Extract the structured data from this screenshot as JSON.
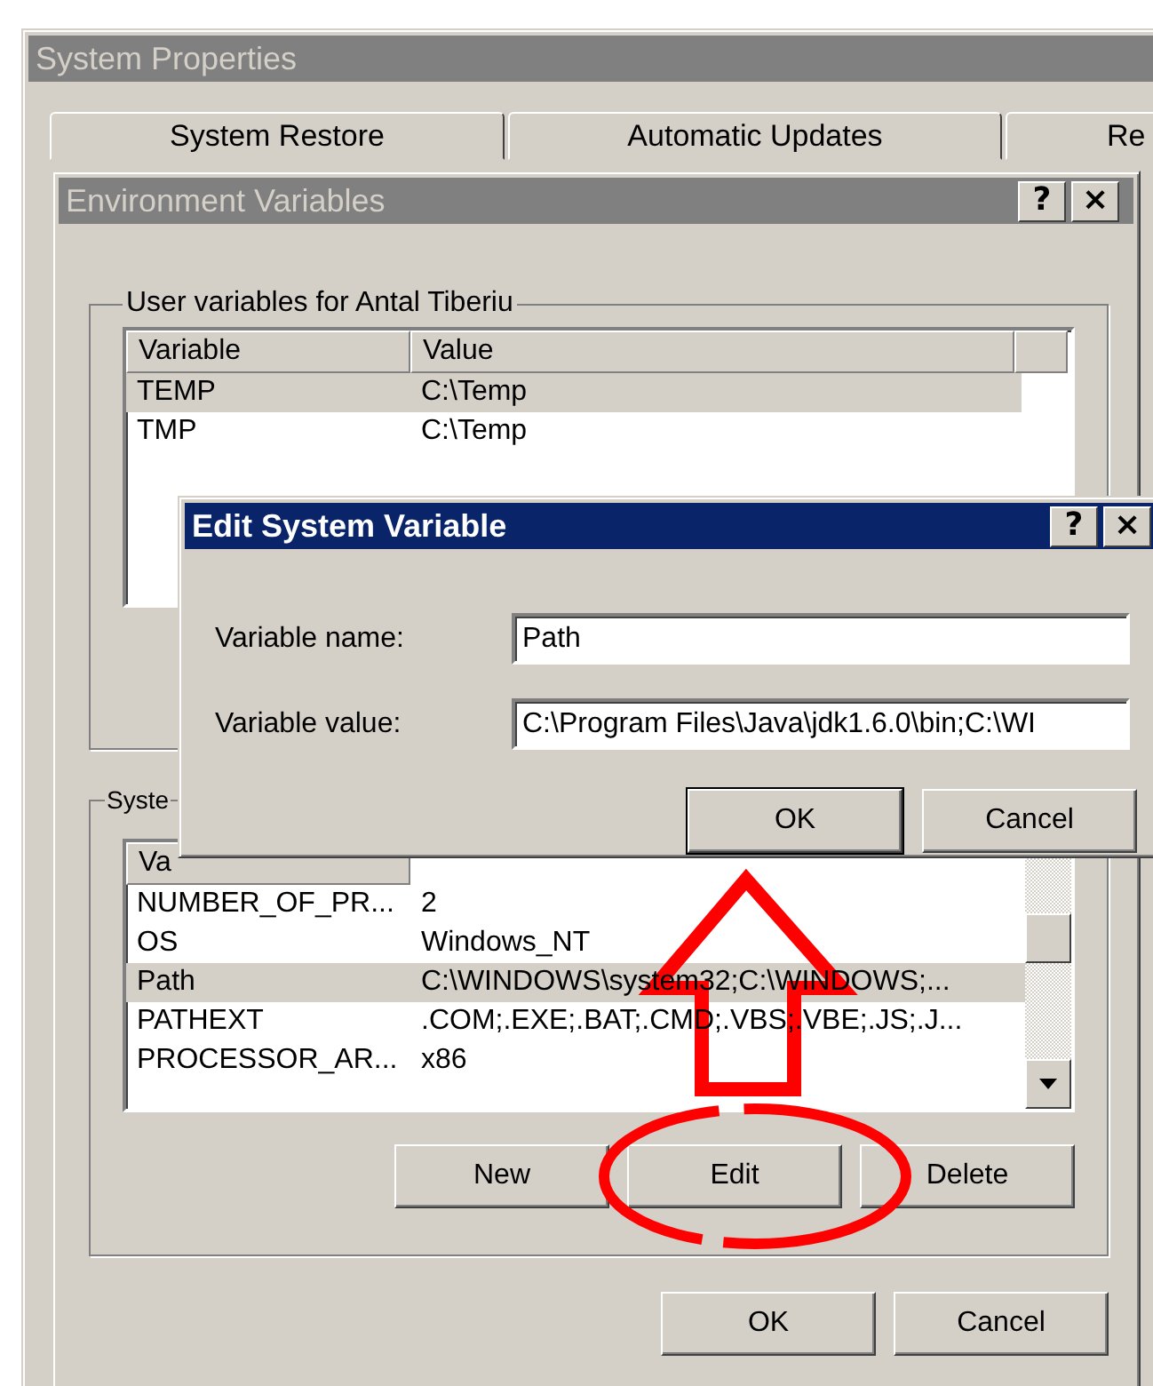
{
  "system_properties": {
    "title": "System Properties",
    "tabs": [
      {
        "label": "System Restore",
        "selected": false
      },
      {
        "label": "Automatic Updates",
        "selected": false
      },
      {
        "label": "Re",
        "selected": false
      }
    ]
  },
  "environment_variables": {
    "title": "Environment Variables",
    "help": "?",
    "close": "×",
    "user_group": {
      "label": "User variables for Antal Tiberiu",
      "columns": [
        "Variable",
        "Value"
      ],
      "rows": [
        {
          "variable": "TEMP",
          "value": "C:\\Temp",
          "selected": true
        },
        {
          "variable": "TMP",
          "value": "C:\\Temp",
          "selected": false
        }
      ]
    },
    "system_group": {
      "label": "Syste",
      "columns": [
        "Va"
      ],
      "rows": [
        {
          "variable": "NUMBER_OF_PR...",
          "value": "2",
          "selected": false
        },
        {
          "variable": "OS",
          "value": "Windows_NT",
          "selected": false
        },
        {
          "variable": "Path",
          "value": "C:\\WINDOWS\\system32;C:\\WINDOWS;...",
          "selected": true
        },
        {
          "variable": "PATHEXT",
          "value": ".COM;.EXE;.BAT;.CMD;.VBS;.VBE;.JS;.J...",
          "selected": false
        },
        {
          "variable": "PROCESSOR_AR...",
          "value": "x86",
          "selected": false
        }
      ]
    },
    "group_buttons": [
      "New",
      "Edit",
      "Delete"
    ],
    "buttons": [
      "OK",
      "Cancel"
    ]
  },
  "edit_dialog": {
    "title": "Edit System Variable",
    "help": "?",
    "close": "×",
    "fields": [
      {
        "label": "Variable name:",
        "value": "Path"
      },
      {
        "label": "Variable value:",
        "value": "C:\\Program Files\\Java\\jdk1.6.0\\bin;C:\\WI"
      }
    ],
    "buttons": [
      {
        "label": "OK",
        "default": true
      },
      {
        "label": "Cancel",
        "default": false
      }
    ]
  }
}
